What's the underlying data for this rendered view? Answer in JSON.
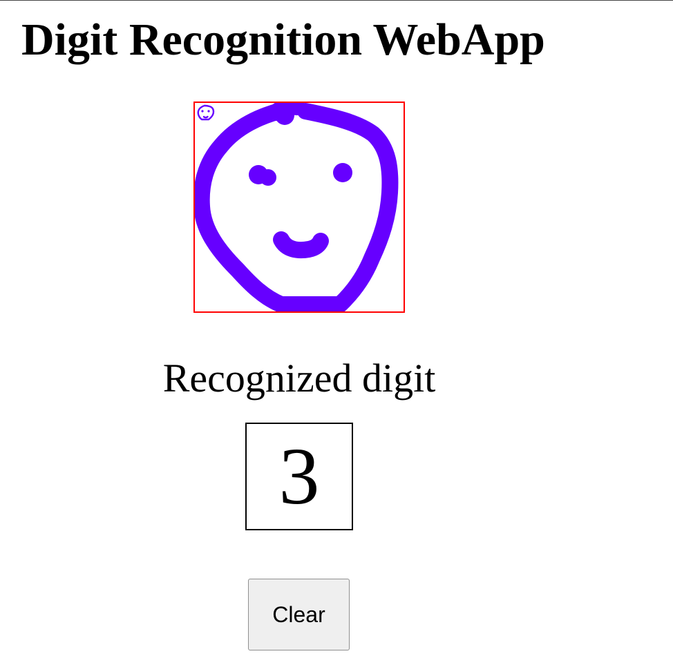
{
  "header": {
    "title": "Digit Recognition WebApp"
  },
  "canvas": {
    "border_color": "#ff0000",
    "stroke_color": "#6600ff",
    "drawing": "smiley-face"
  },
  "result": {
    "label": "Recognized digit",
    "digit": "3"
  },
  "controls": {
    "clear_label": "Clear"
  }
}
